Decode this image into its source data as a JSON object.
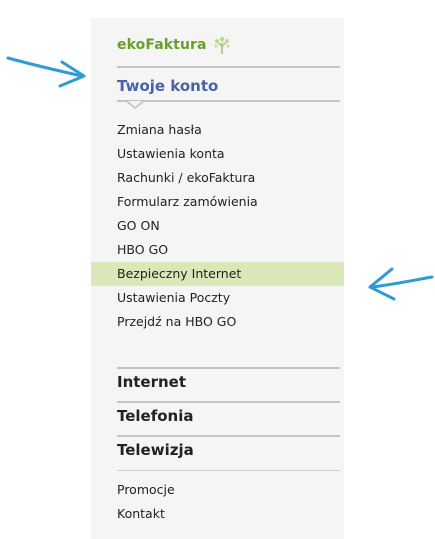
{
  "brand": {
    "label": "ekoFaktura",
    "icon": "tree-icon",
    "color": "#6a9e2c"
  },
  "account": {
    "title": "Twoje konto",
    "color": "#4a63a8"
  },
  "account_menu": [
    {
      "label": "Zmiana hasła",
      "active": false
    },
    {
      "label": "Ustawienia konta",
      "active": false
    },
    {
      "label": "Rachunki / ekoFaktura",
      "active": false
    },
    {
      "label": "Formularz zamówienia",
      "active": false
    },
    {
      "label": "GO ON",
      "active": false
    },
    {
      "label": "HBO GO",
      "active": false
    },
    {
      "label": "Bezpieczny Internet",
      "active": true
    },
    {
      "label": "Ustawienia Poczty",
      "active": false
    },
    {
      "label": "Przejdź na HBO GO",
      "active": false
    }
  ],
  "sections": [
    {
      "label": "Internet"
    },
    {
      "label": "Telefonia"
    },
    {
      "label": "Telewizja"
    }
  ],
  "footer_links": [
    {
      "label": "Promocje"
    },
    {
      "label": "Kontakt"
    }
  ],
  "colors": {
    "highlight": "#d9e8b6",
    "annotation_arrow": "#2f9bd6"
  }
}
